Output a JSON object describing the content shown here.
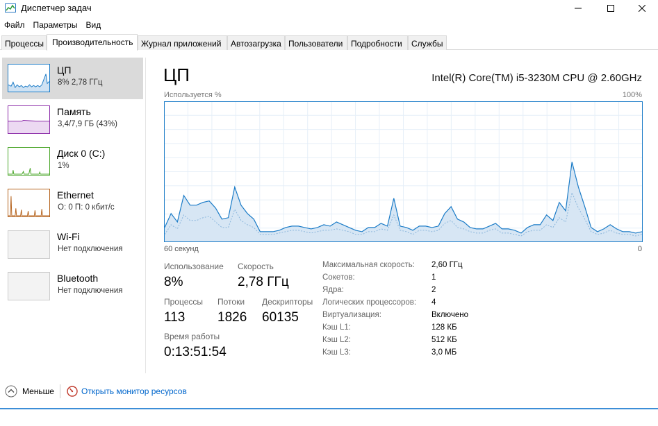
{
  "window": {
    "title": "Диспетчер задач"
  },
  "menu": [
    "Файл",
    "Параметры",
    "Вид"
  ],
  "tabs": [
    "Процессы",
    "Производительность",
    "Журнал приложений",
    "Автозагрузка",
    "Пользователи",
    "Подробности",
    "Службы"
  ],
  "sidebar": [
    {
      "title": "ЦП",
      "sub": "8% 2,78 ГГц",
      "color": "#1a7bc7",
      "selected": true
    },
    {
      "title": "Память",
      "sub": "3,4/7,9 ГБ (43%)",
      "color": "#8b2aa8"
    },
    {
      "title": "Диск 0 (C:)",
      "sub": "1%",
      "color": "#4ca72b"
    },
    {
      "title": "Ethernet",
      "sub": "О: 0 П: 0 кбит/с",
      "color": "#b5621c"
    },
    {
      "title": "Wi-Fi",
      "sub": "Нет подключения",
      "color": "#cccccc"
    },
    {
      "title": "Bluetooth",
      "sub": "Нет подключения",
      "color": "#cccccc"
    }
  ],
  "main": {
    "title": "ЦП",
    "cpu_model": "Intel(R) Core(TM) i5-3230M CPU @ 2.60GHz",
    "graph_label_top": "Используется %",
    "graph_label_top_right": "100%",
    "graph_label_bottom": "60 секунд",
    "graph_label_bottom_right": "0",
    "graph_color": "#1a7bc7",
    "usage_series": [
      10,
      20,
      14,
      33,
      26,
      26,
      28,
      29,
      24,
      16,
      17,
      39,
      26,
      20,
      16,
      7,
      7,
      7,
      8,
      10,
      11,
      11,
      10,
      9,
      10,
      12,
      11,
      14,
      12,
      10,
      8,
      7,
      10,
      10,
      13,
      11,
      31,
      11,
      10,
      8,
      11,
      11,
      10,
      11,
      20,
      25,
      16,
      14,
      10,
      9,
      9,
      11,
      13,
      9,
      9,
      8,
      6,
      10,
      12,
      12,
      19,
      15,
      28,
      22,
      57,
      39,
      25,
      10,
      7,
      9,
      12,
      9,
      7,
      7,
      6,
      7
    ],
    "kernel_series": [
      5,
      12,
      9,
      19,
      15,
      15,
      17,
      18,
      14,
      10,
      10,
      23,
      15,
      12,
      10,
      5,
      5,
      5,
      6,
      7,
      8,
      8,
      7,
      6,
      7,
      8,
      8,
      9,
      8,
      7,
      5,
      5,
      7,
      7,
      9,
      8,
      19,
      8,
      7,
      5,
      8,
      8,
      7,
      8,
      13,
      15,
      10,
      9,
      7,
      6,
      6,
      8,
      9,
      6,
      6,
      5,
      4,
      7,
      8,
      8,
      12,
      10,
      17,
      14,
      35,
      24,
      16,
      7,
      5,
      6,
      8,
      6,
      5,
      5,
      4,
      5
    ]
  },
  "stats": {
    "usage_label": "Использование",
    "usage_value": "8%",
    "speed_label": "Скорость",
    "speed_value": "2,78 ГГц",
    "processes_label": "Процессы",
    "processes_value": "113",
    "threads_label": "Потоки",
    "threads_value": "1826",
    "handles_label": "Дескрипторы",
    "handles_value": "60135",
    "uptime_label": "Время работы",
    "uptime_value": "0:13:51:54"
  },
  "specs": [
    {
      "key": "Максимальная скорость:",
      "value": "2,60 ГГц"
    },
    {
      "key": "Сокетов:",
      "value": "1"
    },
    {
      "key": "Ядра:",
      "value": "2"
    },
    {
      "key": "Логических процессоров:",
      "value": "4"
    },
    {
      "key": "Виртуализация:",
      "value": "Включено"
    },
    {
      "key": "Кэш L1:",
      "value": "128 КБ"
    },
    {
      "key": "Кэш L2:",
      "value": "512 КБ"
    },
    {
      "key": "Кэш L3:",
      "value": "3,0 МБ"
    }
  ],
  "footer": {
    "fewer": "Меньше",
    "resource_monitor": "Открыть монитор ресурсов"
  }
}
